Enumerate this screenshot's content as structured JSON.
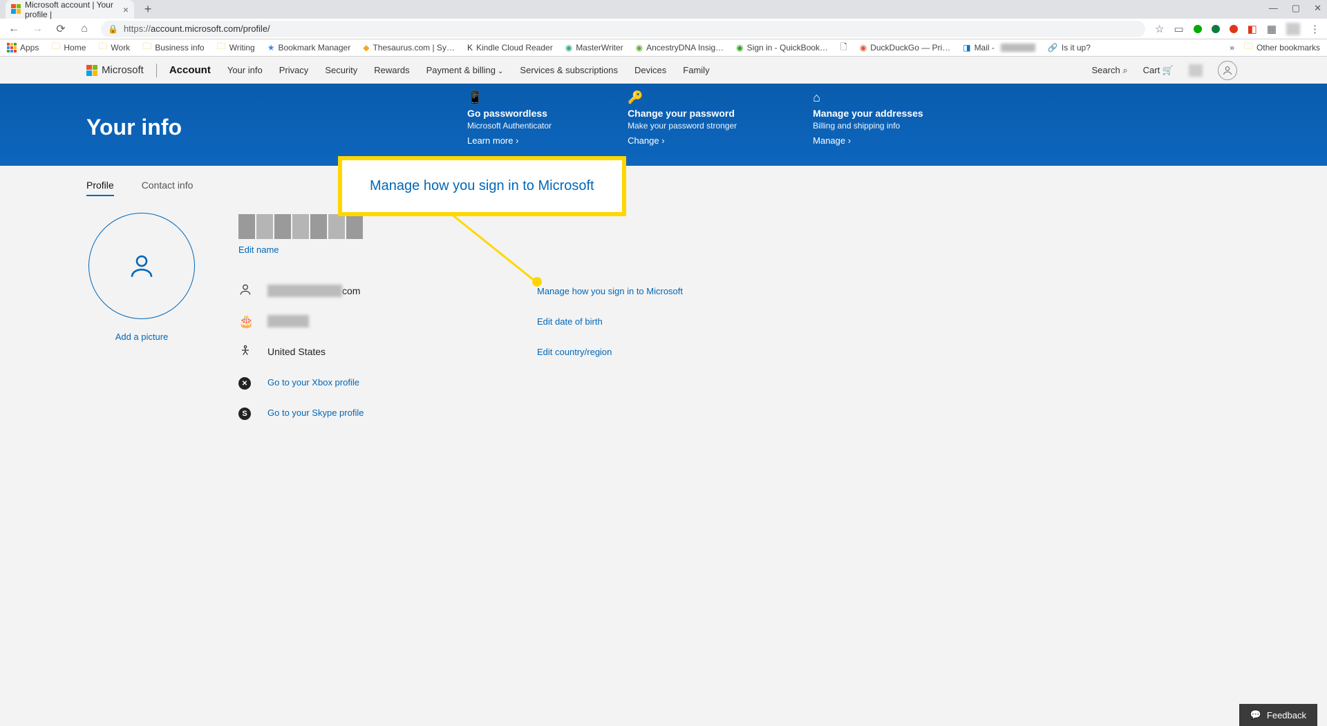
{
  "browser": {
    "tab_title": "Microsoft account | Your profile |",
    "url_proto": "https://",
    "url_rest": "account.microsoft.com/profile/",
    "bookmarks": {
      "apps": "Apps",
      "items": [
        "Home",
        "Work",
        "Business info",
        "Writing",
        "Bookmark Manager",
        "Thesaurus.com | Sy…",
        "Kindle Cloud Reader",
        "MasterWriter",
        "AncestryDNA Insig…",
        "Sign in - QuickBook…",
        "DuckDuckGo — Pri…",
        "Mail -",
        "Is it up?"
      ],
      "other": "Other bookmarks"
    }
  },
  "header": {
    "brand": "Microsoft",
    "account": "Account",
    "nav": [
      "Your info",
      "Privacy",
      "Security",
      "Rewards",
      "Payment & billing",
      "Services & subscriptions",
      "Devices",
      "Family"
    ],
    "search": "Search",
    "cart": "Cart"
  },
  "hero": {
    "title": "Your info",
    "cards": [
      {
        "title": "Go passwordless",
        "sub": "Microsoft Authenticator",
        "link": "Learn more"
      },
      {
        "title": "Change your password",
        "sub": "Make your password stronger",
        "link": "Change"
      },
      {
        "title": "Manage your addresses",
        "sub": "Billing and shipping info",
        "link": "Manage"
      }
    ]
  },
  "tabs": {
    "profile": "Profile",
    "contact": "Contact info"
  },
  "profile": {
    "add_picture": "Add a picture",
    "edit_name": "Edit name",
    "email_suffix": "com",
    "country": "United States",
    "xbox_link": "Go to your Xbox profile",
    "skype_link": "Go to your Skype profile",
    "actions": {
      "signin": "Manage how you sign in to Microsoft",
      "dob": "Edit date of birth",
      "region": "Edit country/region"
    }
  },
  "callout": "Manage how you sign in to Microsoft",
  "feedback": "Feedback"
}
